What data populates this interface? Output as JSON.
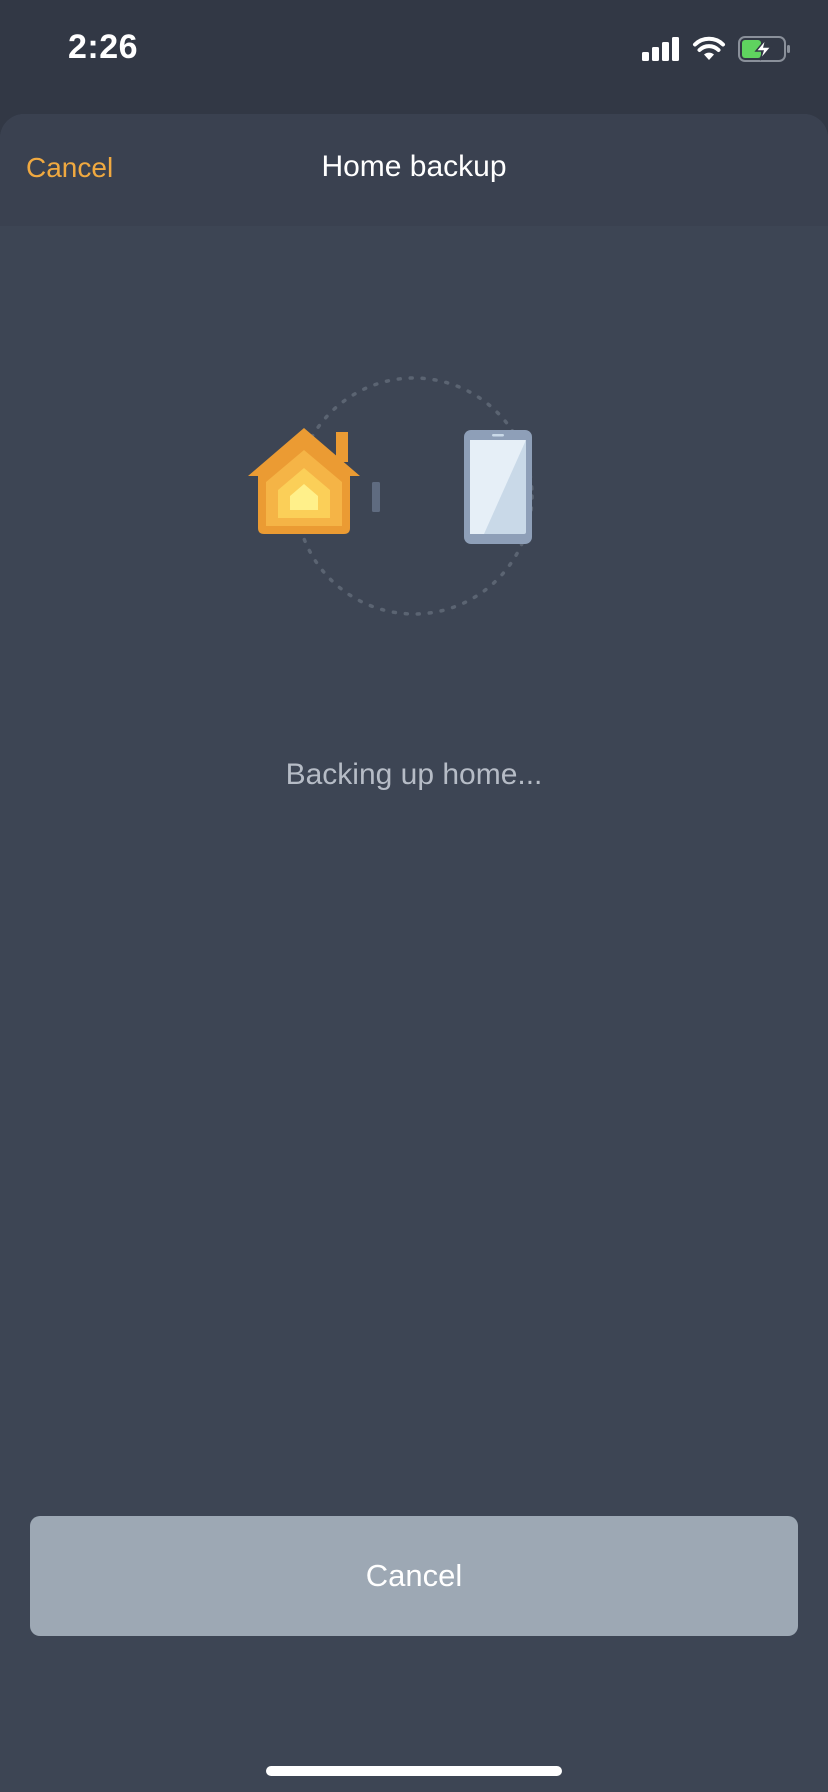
{
  "status_bar": {
    "time": "2:26",
    "icons": [
      "cellular-signal-icon",
      "wifi-icon",
      "battery-charging-icon"
    ]
  },
  "nav": {
    "cancel_label": "Cancel",
    "title": "Home backup"
  },
  "illustration": {
    "icons": [
      "home-app-icon",
      "transfer-indicator",
      "phone-icon"
    ]
  },
  "status": {
    "text": "Backing up home..."
  },
  "footer": {
    "cancel_label": "Cancel"
  },
  "colors": {
    "accent": "#f0a940",
    "background": "#3d4554",
    "button": "#9da8b4",
    "battery_charge": "#5fd35f"
  }
}
